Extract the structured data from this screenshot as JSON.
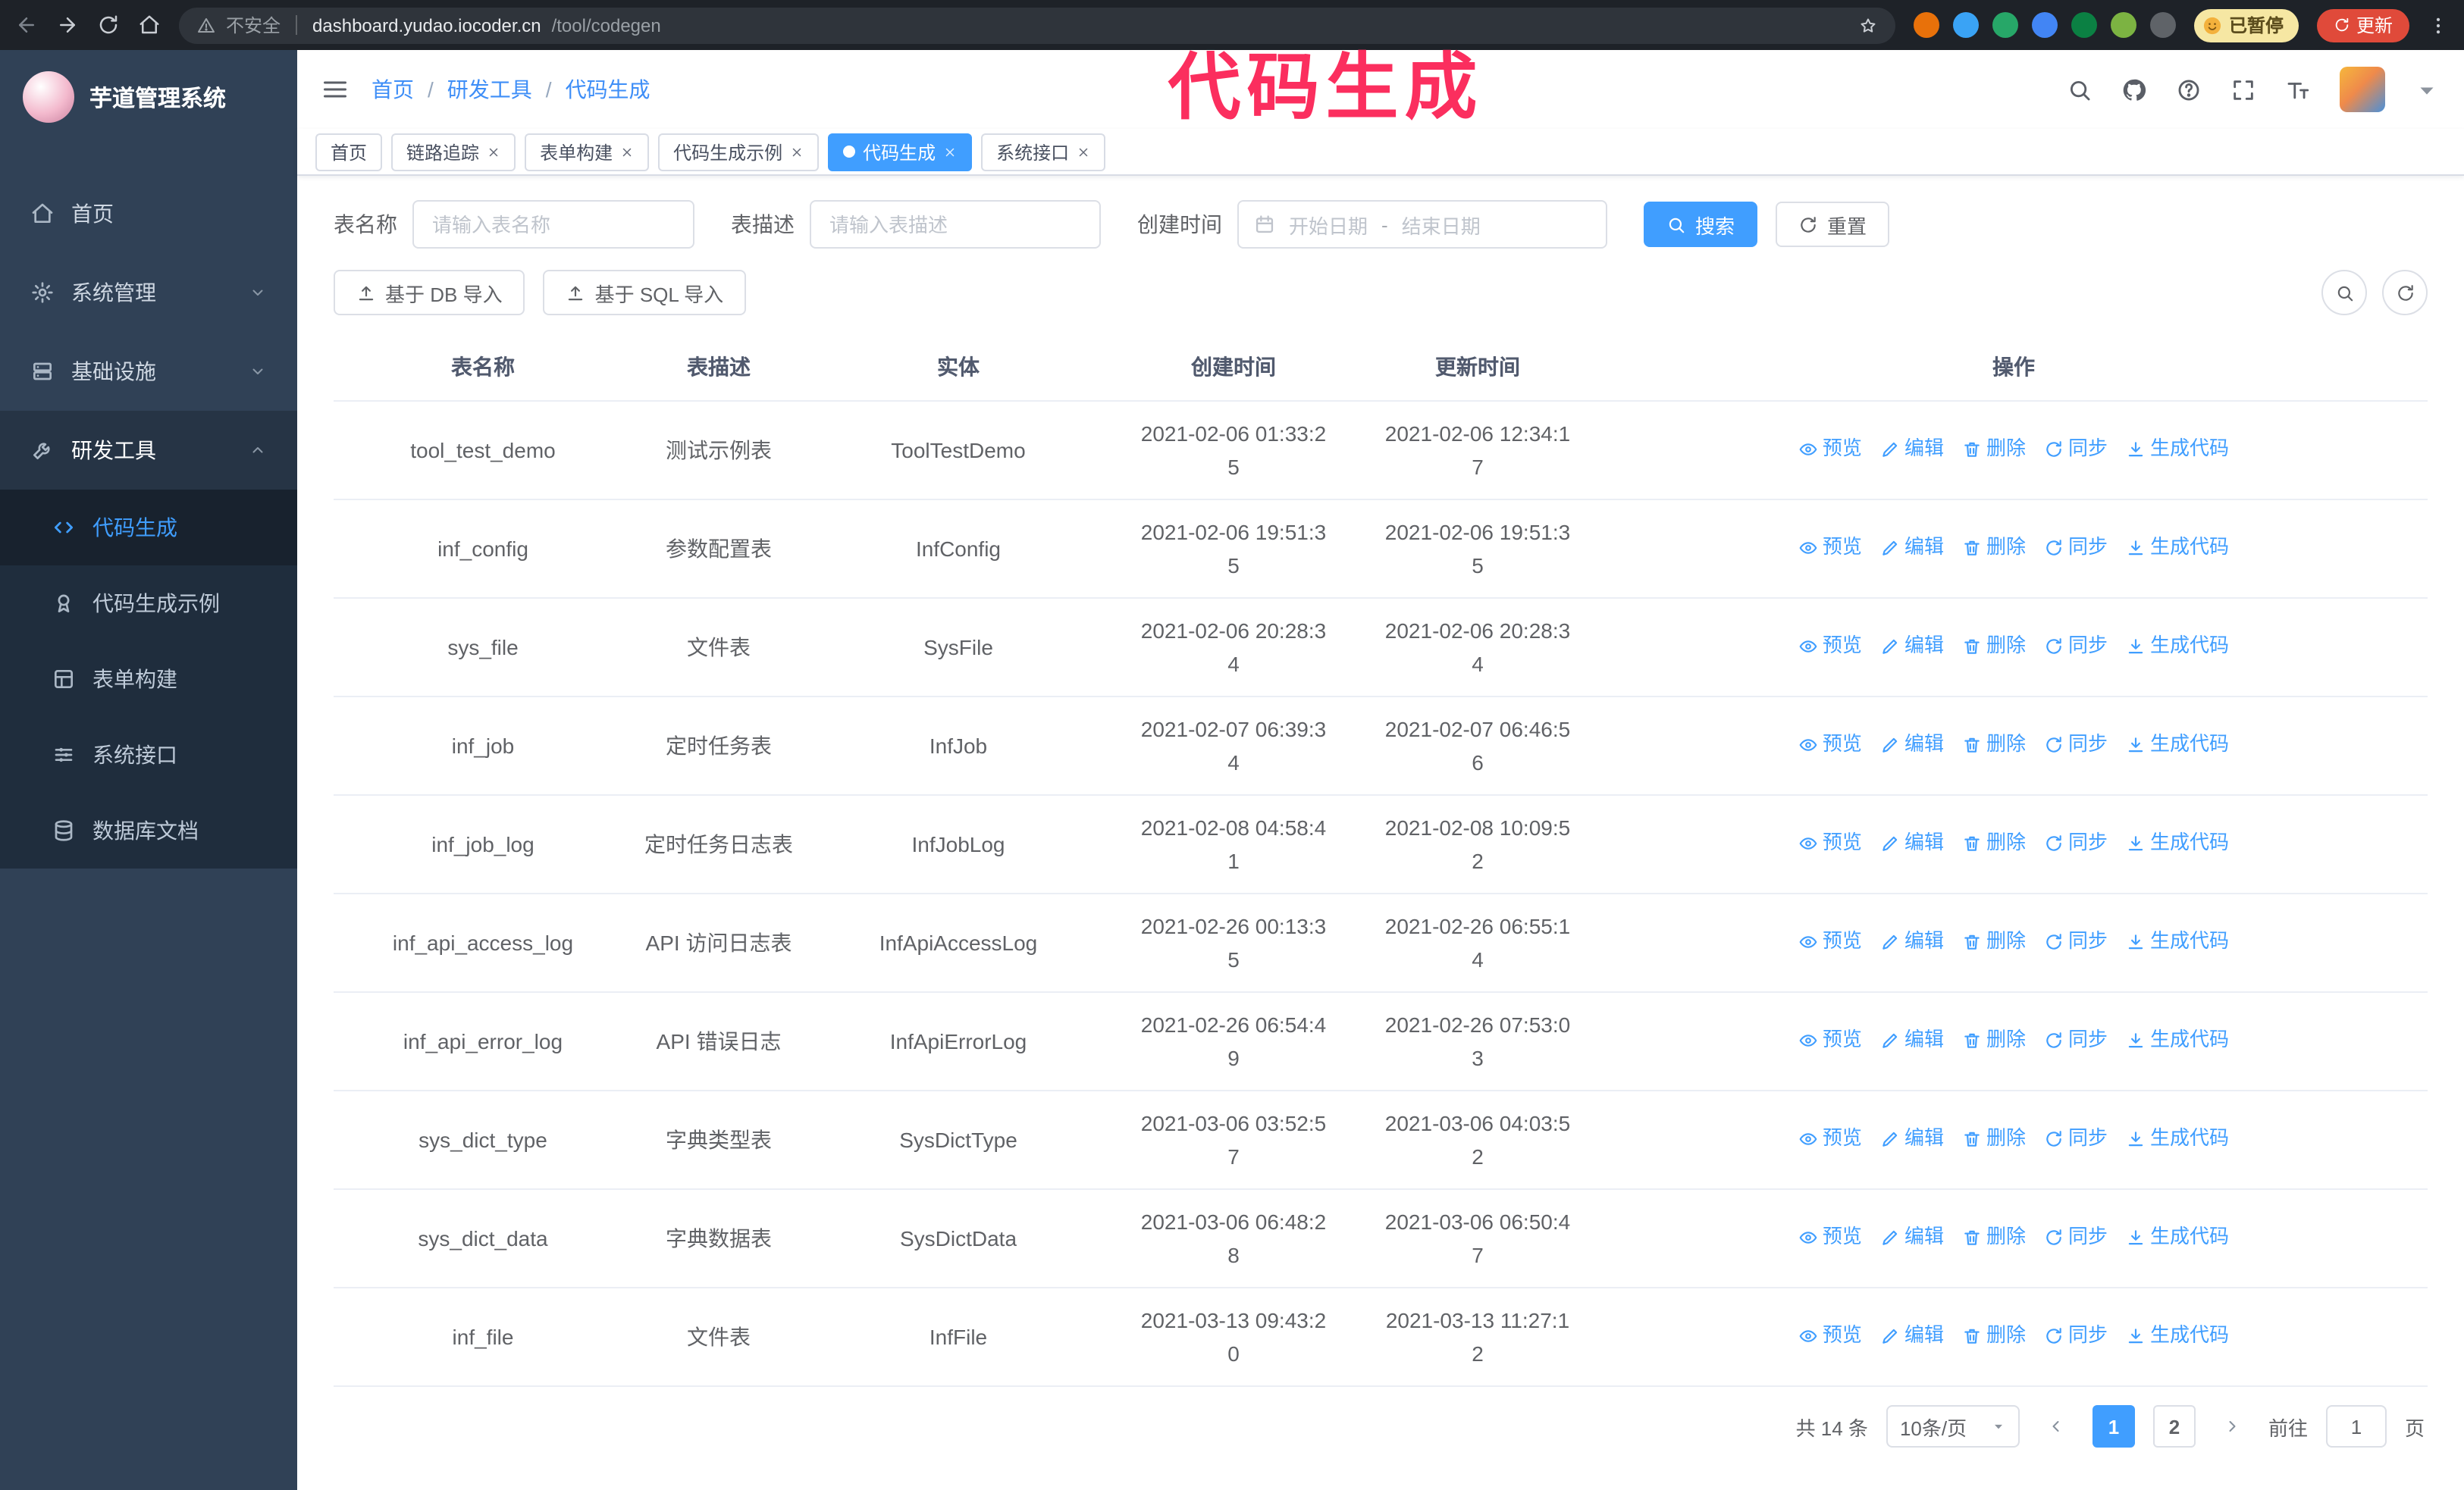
{
  "browser": {
    "security_label": "不安全",
    "url_host": "dashboard.yudao.iocoder.cn",
    "url_path": "/tool/codegen",
    "paused_badge": "已暂停",
    "update_button": "更新",
    "extension_colors": [
      "#e8710a",
      "#3aa3f5",
      "#27a768",
      "#4285f4",
      "#0b8043",
      "#7cb342",
      "#5f6368"
    ]
  },
  "annotation": {
    "text": "代码生成",
    "color": "#fb2e5e"
  },
  "sidebar": {
    "logo_title": "芋道管理系统",
    "items": [
      {
        "label": "首页",
        "icon": "home"
      },
      {
        "label": "系统管理",
        "icon": "gear",
        "expandable": true
      },
      {
        "label": "基础设施",
        "icon": "infra",
        "expandable": true
      },
      {
        "label": "研发工具",
        "icon": "tools",
        "expandable": true,
        "expanded": true,
        "children": [
          {
            "label": "代码生成",
            "icon": "code",
            "active": true
          },
          {
            "label": "代码生成示例",
            "icon": "example"
          },
          {
            "label": "表单构建",
            "icon": "form"
          },
          {
            "label": "系统接口",
            "icon": "api"
          },
          {
            "label": "数据库文档",
            "icon": "database"
          }
        ]
      }
    ]
  },
  "header": {
    "breadcrumb": [
      "首页",
      "研发工具",
      "代码生成"
    ],
    "separator": "/"
  },
  "tabs": [
    {
      "label": "首页",
      "closable": false,
      "active": false
    },
    {
      "label": "链路追踪",
      "closable": true,
      "active": false
    },
    {
      "label": "表单构建",
      "closable": true,
      "active": false
    },
    {
      "label": "代码生成示例",
      "closable": true,
      "active": false
    },
    {
      "label": "代码生成",
      "closable": true,
      "active": true
    },
    {
      "label": "系统接口",
      "closable": true,
      "active": false
    }
  ],
  "filters": {
    "name_label": "表名称",
    "name_placeholder": "请输入表名称",
    "desc_label": "表描述",
    "desc_placeholder": "请输入表描述",
    "time_label": "创建时间",
    "start_placeholder": "开始日期",
    "separator": "-",
    "end_placeholder": "结束日期",
    "search_button": "搜索",
    "reset_button": "重置"
  },
  "toolbar": {
    "import_db": "基于 DB 导入",
    "import_sql": "基于 SQL 导入"
  },
  "table": {
    "columns": [
      "表名称",
      "表描述",
      "实体",
      "创建时间",
      "更新时间",
      "操作"
    ],
    "actions": [
      {
        "label": "预览",
        "icon": "eye"
      },
      {
        "label": "编辑",
        "icon": "edit"
      },
      {
        "label": "删除",
        "icon": "delete"
      },
      {
        "label": "同步",
        "icon": "sync"
      },
      {
        "label": "生成代码",
        "icon": "generate"
      }
    ],
    "rows": [
      {
        "name": "tool_test_demo",
        "desc": "测试示例表",
        "entity": "ToolTestDemo",
        "created": "2021-02-06 01:33:25",
        "updated": "2021-02-06 12:34:17"
      },
      {
        "name": "inf_config",
        "desc": "参数配置表",
        "entity": "InfConfig",
        "created": "2021-02-06 19:51:35",
        "updated": "2021-02-06 19:51:35"
      },
      {
        "name": "sys_file",
        "desc": "文件表",
        "entity": "SysFile",
        "created": "2021-02-06 20:28:34",
        "updated": "2021-02-06 20:28:34"
      },
      {
        "name": "inf_job",
        "desc": "定时任务表",
        "entity": "InfJob",
        "created": "2021-02-07 06:39:34",
        "updated": "2021-02-07 06:46:56"
      },
      {
        "name": "inf_job_log",
        "desc": "定时任务日志表",
        "entity": "InfJobLog",
        "created": "2021-02-08 04:58:41",
        "updated": "2021-02-08 10:09:52"
      },
      {
        "name": "inf_api_access_log",
        "desc": "API 访问日志表",
        "entity": "InfApiAccessLog",
        "created": "2021-02-26 00:13:35",
        "updated": "2021-02-26 06:55:14"
      },
      {
        "name": "inf_api_error_log",
        "desc": "API 错误日志",
        "entity": "InfApiErrorLog",
        "created": "2021-02-26 06:54:49",
        "updated": "2021-02-26 07:53:03"
      },
      {
        "name": "sys_dict_type",
        "desc": "字典类型表",
        "entity": "SysDictType",
        "created": "2021-03-06 03:52:57",
        "updated": "2021-03-06 04:03:52"
      },
      {
        "name": "sys_dict_data",
        "desc": "字典数据表",
        "entity": "SysDictData",
        "created": "2021-03-06 06:48:28",
        "updated": "2021-03-06 06:50:47"
      },
      {
        "name": "inf_file",
        "desc": "文件表",
        "entity": "InfFile",
        "created": "2021-03-13 09:43:20",
        "updated": "2021-03-13 11:27:12"
      }
    ]
  },
  "pagination": {
    "total_text": "共 14 条",
    "page_size": "10条/页",
    "pages": [
      "1",
      "2"
    ],
    "active_page": "1",
    "goto_label": "前往",
    "goto_value": "1",
    "goto_suffix": "页"
  },
  "colors": {
    "primary": "#409eff",
    "sidebar_bg": "#304156",
    "submenu_bg": "#1f2d3d",
    "chrome_bg": "#1e2228",
    "update_button_bg": "#e04a3a",
    "paused_badge_bg": "#f6e7a3"
  }
}
